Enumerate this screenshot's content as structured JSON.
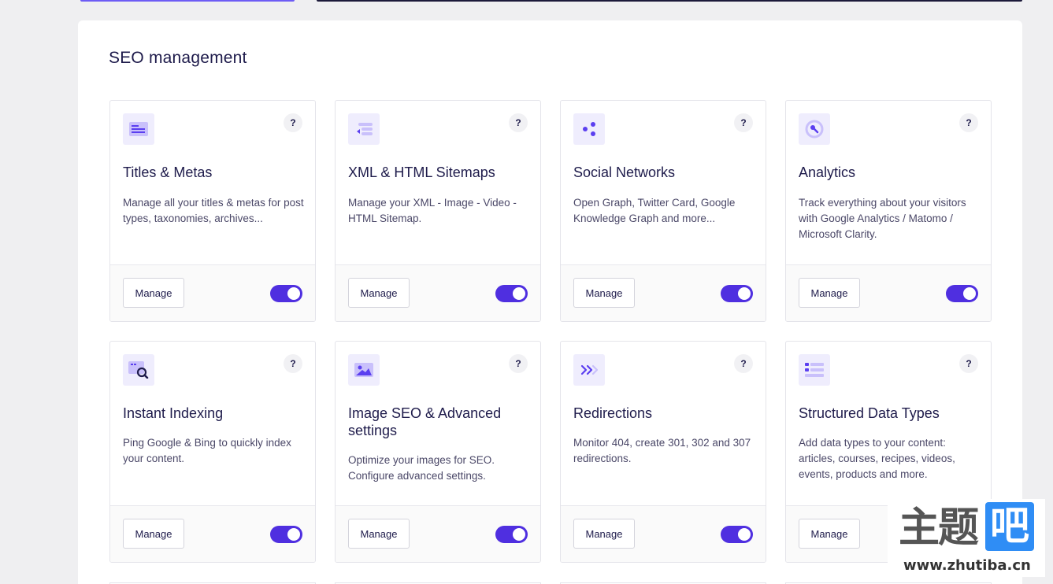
{
  "panel": {
    "title": "SEO management"
  },
  "common": {
    "manage_label": "Manage",
    "help_label": "?"
  },
  "cards": [
    {
      "title": "Titles & Metas",
      "description": "Manage all your titles & metas for post types, taxonomies, archives...",
      "icon": "titles-metas-icon",
      "enabled": true
    },
    {
      "title": "XML & HTML Sitemaps",
      "description": "Manage your XML - Image - Video - HTML Sitemap.",
      "icon": "sitemap-icon",
      "enabled": true
    },
    {
      "title": "Social Networks",
      "description": "Open Graph, Twitter Card, Google Knowledge Graph and more...",
      "icon": "share-icon",
      "enabled": true
    },
    {
      "title": "Analytics",
      "description": "Track everything about your visitors with Google Analytics / Matomo / Microsoft Clarity.",
      "icon": "analytics-icon",
      "enabled": true
    },
    {
      "title": "Instant Indexing",
      "description": "Ping Google & Bing to quickly index your content.",
      "icon": "instant-indexing-icon",
      "enabled": true
    },
    {
      "title": "Image SEO & Advanced settings",
      "description": "Optimize your images for SEO. Configure advanced settings.",
      "icon": "image-icon",
      "enabled": true
    },
    {
      "title": "Redirections",
      "description": "Monitor 404, create 301, 302 and 307 redirections.",
      "icon": "redirect-icon",
      "enabled": true
    },
    {
      "title": "Structured Data Types",
      "description": "Add data types to your content: articles, courses, recipes, videos, events, products and more.",
      "icon": "structured-data-icon",
      "enabled": true
    }
  ],
  "watermark": {
    "main": "主题",
    "accent": "吧",
    "url": "www.zhutiba.cn"
  },
  "colors": {
    "accent": "#4f2fe0",
    "icon_bg": "#efedfd",
    "icon_fg": "#5b3ff0"
  }
}
